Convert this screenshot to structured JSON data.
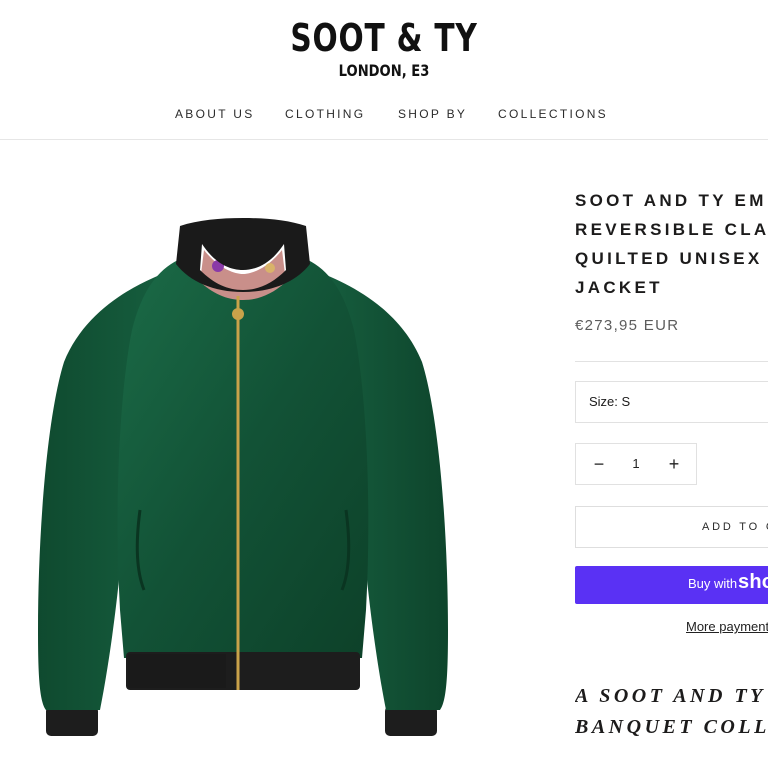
{
  "brand": {
    "name": "SOOT & TY",
    "location": "LONDON, E3"
  },
  "nav": {
    "items": [
      {
        "label": "ABOUT US"
      },
      {
        "label": "CLOTHING"
      },
      {
        "label": "SHOP BY"
      },
      {
        "label": "COLLECTIONS"
      }
    ]
  },
  "product": {
    "title_lines": [
      "SOOT AND TY EM",
      "REVERSIBLE CLASS",
      "QUILTED UNISEX B",
      "JACKET"
    ],
    "price": "€273,95 EUR",
    "size_label": "Size: S",
    "quantity": "1",
    "add_to_cart": "ADD TO C",
    "buy_with": "Buy with",
    "buy_brand": "sho",
    "more_payment": "More payment",
    "description_heading_lines": [
      "A SOOT AND TY",
      "BANQUET COLLE"
    ],
    "image_colors": {
      "body": "#145a3c",
      "collar": "#1a1a1a",
      "zipper": "#c9a24a"
    }
  },
  "colors": {
    "buy_button": "#5a31f4",
    "text": "#1c1b1b",
    "border": "#e1e1e1"
  }
}
